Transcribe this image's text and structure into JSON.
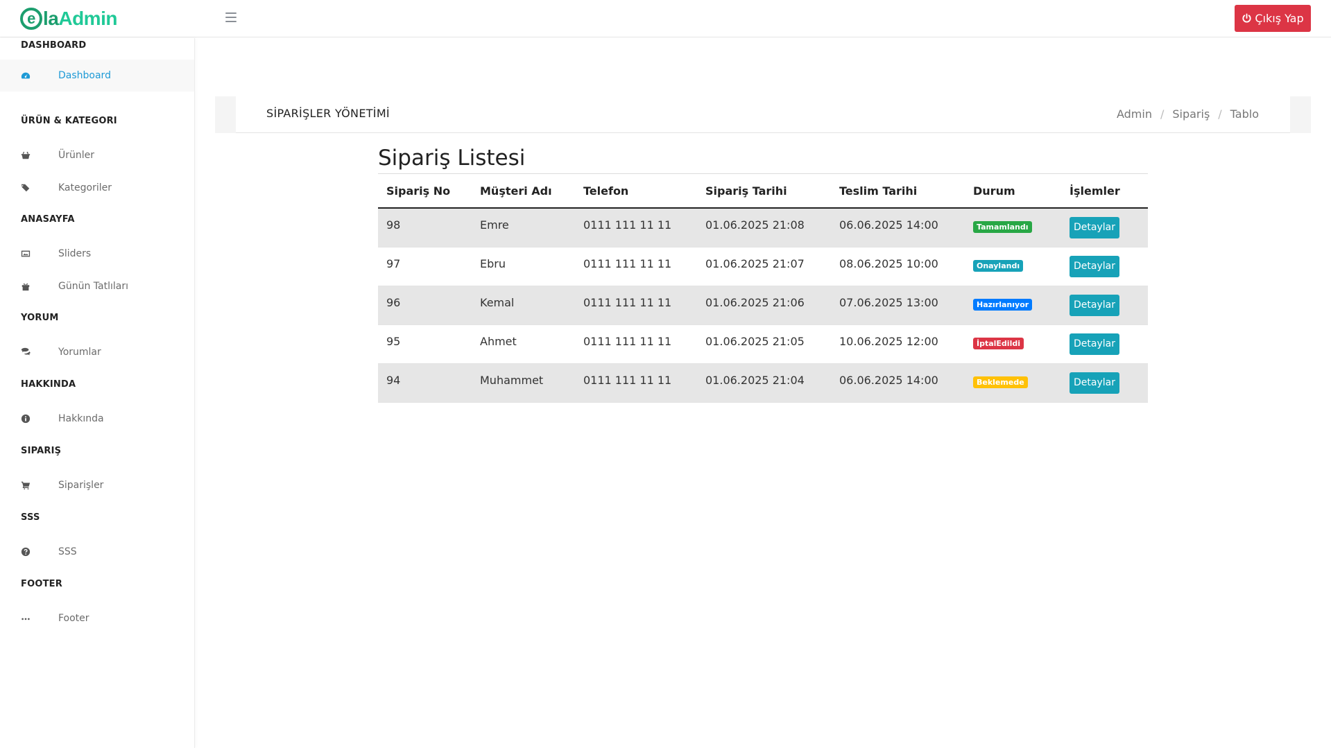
{
  "brand": {
    "e": "e",
    "la": "la",
    "admin": "Admin"
  },
  "header": {
    "logout_label": "Çıkış Yap"
  },
  "sidebar": {
    "sections": [
      {
        "title": "DASHBOARD",
        "items": [
          {
            "label": "Dashboard",
            "icon": "dashboard-icon",
            "active": true
          }
        ]
      },
      {
        "title": "ÜRÜN & KATEGORI",
        "items": [
          {
            "label": "Ürünler",
            "icon": "basket-icon"
          },
          {
            "label": "Kategoriler",
            "icon": "tags-icon"
          }
        ]
      },
      {
        "title": "ANASAYFA",
        "items": [
          {
            "label": "Sliders",
            "icon": "image-icon"
          },
          {
            "label": "Günün Tatlıları",
            "icon": "gift-icon"
          }
        ]
      },
      {
        "title": "YORUM",
        "items": [
          {
            "label": "Yorumlar",
            "icon": "comments-icon"
          }
        ]
      },
      {
        "title": "HAKKINDA",
        "items": [
          {
            "label": "Hakkında",
            "icon": "info-icon"
          }
        ]
      },
      {
        "title": "SIPARIŞ",
        "items": [
          {
            "label": "Siparişler",
            "icon": "cart-icon"
          }
        ]
      },
      {
        "title": "SSS",
        "items": [
          {
            "label": "SSS",
            "icon": "question-icon"
          }
        ]
      },
      {
        "title": "FOOTER",
        "items": [
          {
            "label": "Footer",
            "icon": "ellipsis-icon"
          }
        ]
      }
    ]
  },
  "page": {
    "title": "SİPARİŞLER YÖNETİMİ",
    "breadcrumb": [
      "Admin",
      "Sipariş",
      "Tablo"
    ],
    "list_title": "Sipariş Listesi"
  },
  "table": {
    "headers": [
      "Sipariş No",
      "Müşteri Adı",
      "Telefon",
      "Sipariş Tarihi",
      "Teslim Tarihi",
      "Durum",
      "İşlemler"
    ],
    "action_label": "Detaylar",
    "rows": [
      {
        "no": "98",
        "name": "Emre",
        "phone": "0111 111 11 11",
        "order_date": "01.06.2025 21:08",
        "delivery_date": "06.06.2025 14:00",
        "status": "Tamamlandı",
        "status_color": "#28a745"
      },
      {
        "no": "97",
        "name": "Ebru",
        "phone": "0111 111 11 11",
        "order_date": "01.06.2025 21:07",
        "delivery_date": "08.06.2025 10:00",
        "status": "Onaylandı",
        "status_color": "#17a2b8"
      },
      {
        "no": "96",
        "name": "Kemal",
        "phone": "0111 111 11 11",
        "order_date": "01.06.2025 21:06",
        "delivery_date": "07.06.2025 13:00",
        "status": "Hazırlanıyor",
        "status_color": "#007bff"
      },
      {
        "no": "95",
        "name": "Ahmet",
        "phone": "0111 111 11 11",
        "order_date": "01.06.2025 21:05",
        "delivery_date": "10.06.2025 12:00",
        "status": "İptalEdildi",
        "status_color": "#dc3545"
      },
      {
        "no": "94",
        "name": "Muhammet",
        "phone": "0111 111 11 11",
        "order_date": "01.06.2025 21:04",
        "delivery_date": "06.06.2025 14:00",
        "status": "Beklemede",
        "status_color": "#ffc107"
      }
    ]
  },
  "colors": {
    "brand_dark": "#1c9e6e",
    "brand_light": "#20c997",
    "danger": "#dc3545",
    "info": "#17a2b8",
    "active_link": "#1e9ad6"
  }
}
